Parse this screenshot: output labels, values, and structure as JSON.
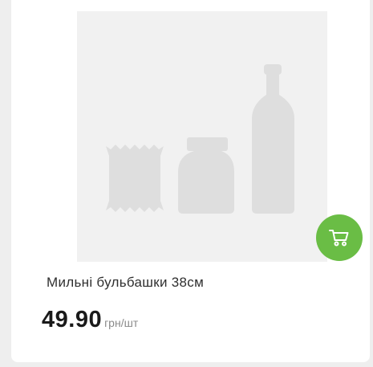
{
  "product": {
    "name": "Мильні бульбашки 38см",
    "price": "49.90",
    "unit": "грн/шт",
    "image_icon": "product-placeholder-icon"
  },
  "actions": {
    "cart_icon": "cart-icon",
    "favorite_icon": "heart-icon"
  },
  "colors": {
    "accent": "#6abd45",
    "placeholder_bg": "#f1f1f1",
    "placeholder_shapes": "#dedede",
    "text": "#2f2f2f",
    "unit_text": "#8a8a8a"
  }
}
